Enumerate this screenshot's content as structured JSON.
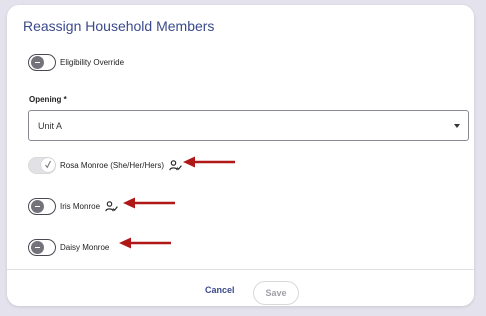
{
  "dialog": {
    "title": "Reassign Household Members",
    "eligibility_override": {
      "label": "Eligibility Override",
      "checked": false
    },
    "opening": {
      "label": "Opening *",
      "selected": "Unit A"
    },
    "members": [
      {
        "label": "Rosa Monroe (She/Her/Hers)",
        "checked": true,
        "disabled": true,
        "icon": "person-check-icon"
      },
      {
        "label": "Iris Monroe",
        "checked": false,
        "icon": "person-check-icon"
      },
      {
        "label": "Daisy Monroe",
        "checked": false
      }
    ],
    "actions": {
      "cancel_label": "Cancel",
      "save_label": "Save"
    }
  },
  "colors": {
    "accent": "#3b4a8c",
    "annotation_arrow": "#b01818",
    "background": "#e4e2ec"
  }
}
